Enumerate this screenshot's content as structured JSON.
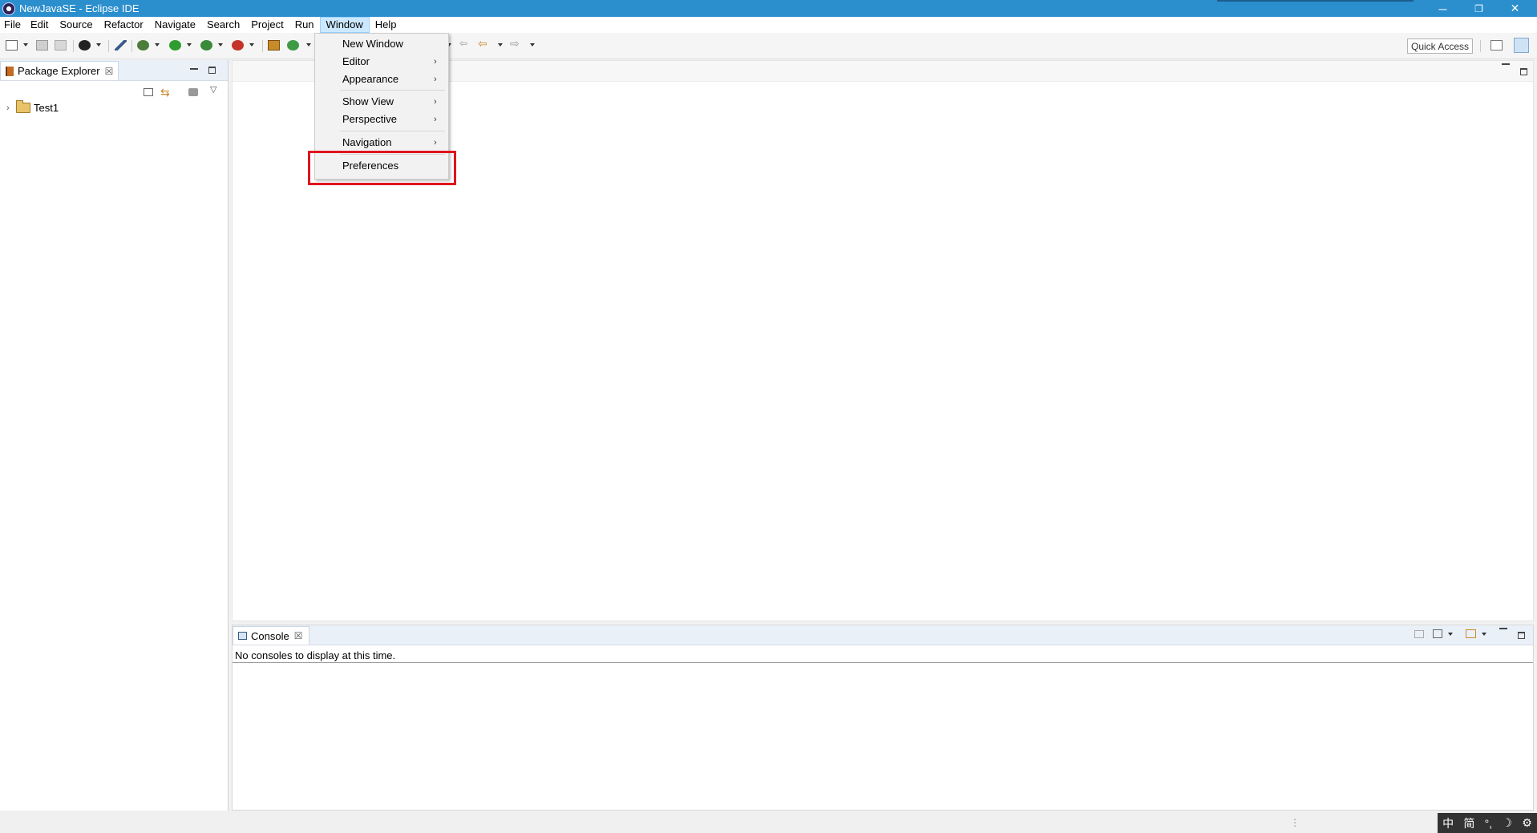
{
  "window": {
    "title": "NewJavaSE - Eclipse IDE",
    "controls": {
      "minimize": "─",
      "restore": "❐",
      "close": "✕"
    }
  },
  "menubar": {
    "items": [
      "File",
      "Edit",
      "Source",
      "Refactor",
      "Navigate",
      "Search",
      "Project",
      "Run",
      "Window",
      "Help"
    ],
    "active": "Window"
  },
  "window_menu": {
    "items": [
      {
        "label": "New Window",
        "submenu": false
      },
      {
        "label": "Editor",
        "submenu": true
      },
      {
        "label": "Appearance",
        "submenu": true
      },
      {
        "label": "Show View",
        "submenu": true
      },
      {
        "label": "Perspective",
        "submenu": true
      },
      {
        "label": "Navigation",
        "submenu": true
      },
      {
        "label": "Preferences",
        "submenu": false
      }
    ],
    "highlighted": "Preferences"
  },
  "toolbar": {
    "quick_access": "Quick Access"
  },
  "package_explorer": {
    "tab_label": "Package Explorer",
    "tree": [
      {
        "label": "Test1",
        "expanded": false
      }
    ]
  },
  "console": {
    "tab_label": "Console",
    "message": "No consoles to display at this time."
  },
  "ime": {
    "items": [
      "中",
      "简",
      "°,",
      "☽",
      "⚙"
    ]
  },
  "colors": {
    "titlebar": "#2b8ecd",
    "highlight_box": "#e0141d"
  }
}
